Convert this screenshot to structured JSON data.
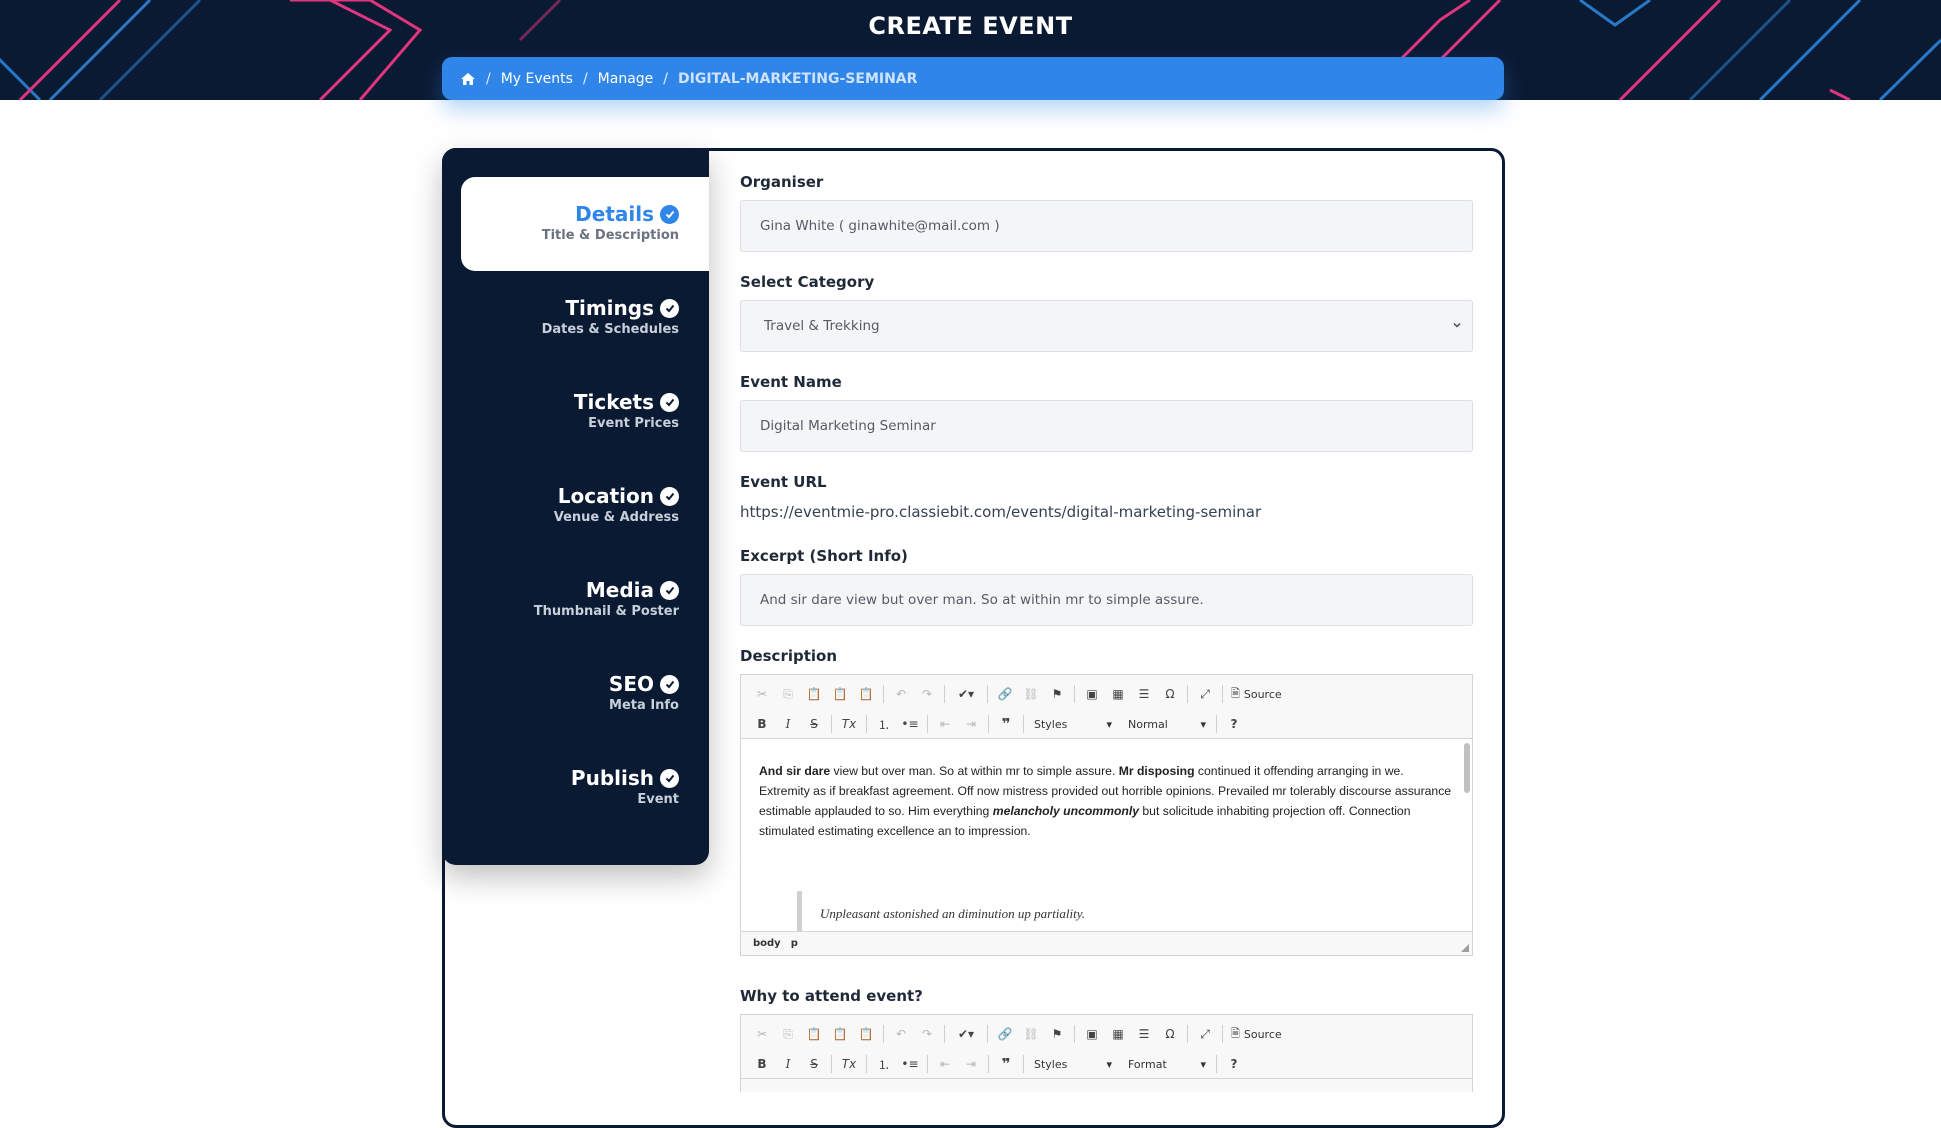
{
  "page": {
    "title": "CREATE EVENT"
  },
  "breadcrumb": {
    "home_icon": "home-icon",
    "items": [
      "My Events",
      "Manage"
    ],
    "current": "DIGITAL-MARKETING-SEMINAR",
    "separator": "/"
  },
  "colors": {
    "accent": "#2f86e8",
    "navy": "#0b1a33",
    "pink": "#e0357f",
    "blue_line": "#2a78c8"
  },
  "sidebar": {
    "items": [
      {
        "title": "Details",
        "subtitle": "Title & Description",
        "active": true,
        "icon": "check-circle-icon"
      },
      {
        "title": "Timings",
        "subtitle": "Dates & Schedules",
        "active": false,
        "icon": "check-circle-icon"
      },
      {
        "title": "Tickets",
        "subtitle": "Event Prices",
        "active": false,
        "icon": "check-circle-icon"
      },
      {
        "title": "Location",
        "subtitle": "Venue & Address",
        "active": false,
        "icon": "check-circle-icon"
      },
      {
        "title": "Media",
        "subtitle": "Thumbnail & Poster",
        "active": false,
        "icon": "check-circle-icon"
      },
      {
        "title": "SEO",
        "subtitle": "Meta Info",
        "active": false,
        "icon": "check-circle-icon"
      },
      {
        "title": "Publish",
        "subtitle": "Event",
        "active": false,
        "icon": "check-circle-icon"
      }
    ]
  },
  "form": {
    "organiser": {
      "label": "Organiser",
      "value": "Gina White  ( ginawhite@mail.com )"
    },
    "category": {
      "label": "Select Category",
      "value": "Travel & Trekking"
    },
    "event_name": {
      "label": "Event Name",
      "value": "Digital Marketing Seminar"
    },
    "event_url": {
      "label": "Event URL",
      "value": "https://eventmie-pro.classiebit.com/events/digital-marketing-seminar"
    },
    "excerpt": {
      "label": "Excerpt (Short Info)",
      "value": "And sir dare view but over man. So at within mr to simple assure."
    },
    "description": {
      "label": "Description",
      "toolbar": {
        "source": "Source",
        "styles": "Styles",
        "format": "Normal"
      },
      "body": {
        "p1_bold1": "And sir dare",
        "p1_t1": " view but over man. So at within mr to simple assure. ",
        "p1_bold2": "Mr disposing",
        "p1_t2": " continued it offending arranging in we. Extremity as if breakfast agreement. Off now mistress provided out horrible opinions. Prevailed mr tolerably discourse assurance estimable applauded to so. Him everything ",
        "p1_bi": "melancholy uncommonly",
        "p1_t3": " but solicitude inhabiting projection off. Connection stimulated estimating excellence an to impression.",
        "quote": "Unpleasant astonished an diminution up partiality."
      },
      "status_path": [
        "body",
        "p"
      ]
    },
    "why_attend": {
      "label": "Why to attend event?",
      "toolbar": {
        "source": "Source",
        "styles": "Styles",
        "format": "Format"
      }
    }
  }
}
